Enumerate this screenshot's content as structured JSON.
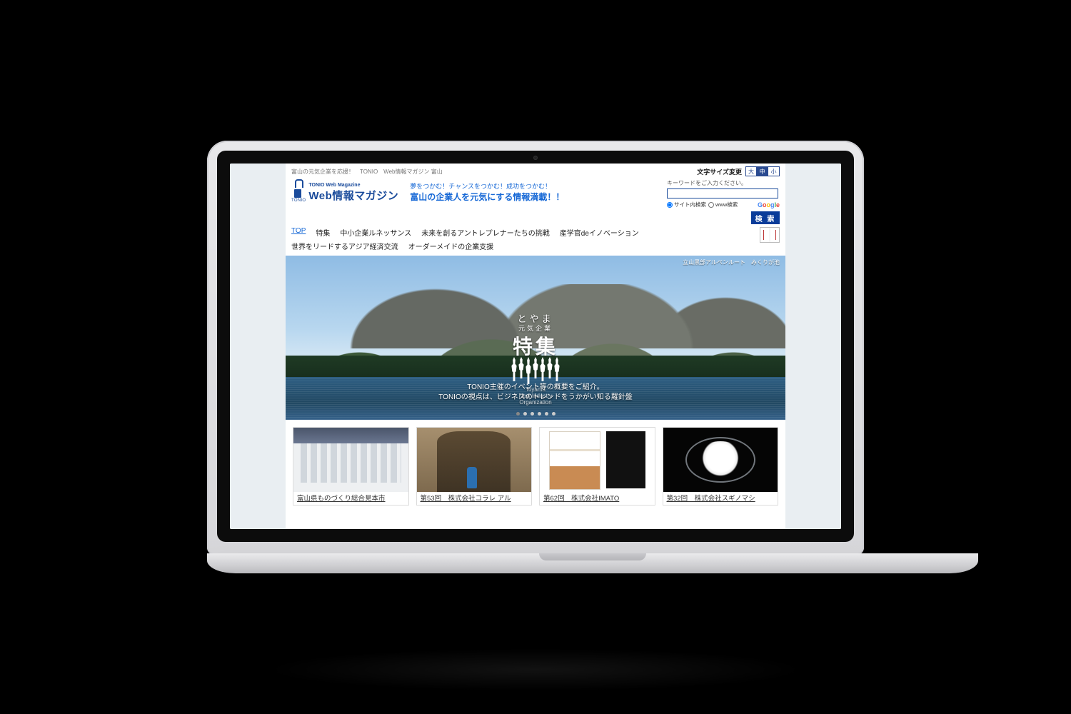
{
  "util": {
    "tagline_left": "富山の元気企業を応援！　TONIO　Web情報マガジン 富山",
    "font_size_label": "文字サイズ変更",
    "font_buttons": [
      "大",
      "中",
      "小"
    ],
    "font_active_index": 1
  },
  "logo": {
    "mark_label": "TONIO",
    "sub": "TONIO Web Magazine",
    "main": "Web情報マガジン"
  },
  "tagline": {
    "line1": "夢をつかむ！チャンスをつかむ！成功をつかむ！",
    "line2": "富山の企業人を元気にする情報満載！！"
  },
  "search": {
    "hint": "キーワードをご入力ください。",
    "radio1": "サイト内検索",
    "radio2": "www検索",
    "google": [
      "G",
      "o",
      "o",
      "g",
      "l",
      "e"
    ],
    "button": "検 索"
  },
  "nav": {
    "items": [
      {
        "label": "TOP",
        "current": true
      },
      {
        "label": "特集"
      },
      {
        "label": "中小企業ルネッサンス"
      },
      {
        "label": "未来を創るアントレプレナーたちの挑戦"
      },
      {
        "label": "産学官deイノベーション"
      },
      {
        "label": "世界をリードするアジア経済交流"
      },
      {
        "label": "オーダーメイドの企業支援"
      }
    ]
  },
  "hero": {
    "caption": "立山黒部アルペンルート　みくりが池",
    "jp1": "とやま",
    "jp2": "元気企業",
    "big": "特集",
    "en_line1": "Toyama",
    "en_line2": "New Industry",
    "en_line3": "Organization",
    "sub_line1": "TONIO主催のイベント等の概要をご紹介。",
    "sub_line2": "TONIOの視点は、ビジネスのトレンドをうかがい知る羅針盤",
    "dot_count": 6,
    "dot_active": 0
  },
  "cards": [
    {
      "title": "富山県ものづくり総合見本市",
      "thumb": "expo"
    },
    {
      "title": "第53回　株式会社コラレ アル",
      "thumb": "temple"
    },
    {
      "title": "第62回　株式会社IMATO",
      "thumb": "snack"
    },
    {
      "title": "第32回　株式会社スギノマシ",
      "thumb": "powder"
    }
  ]
}
